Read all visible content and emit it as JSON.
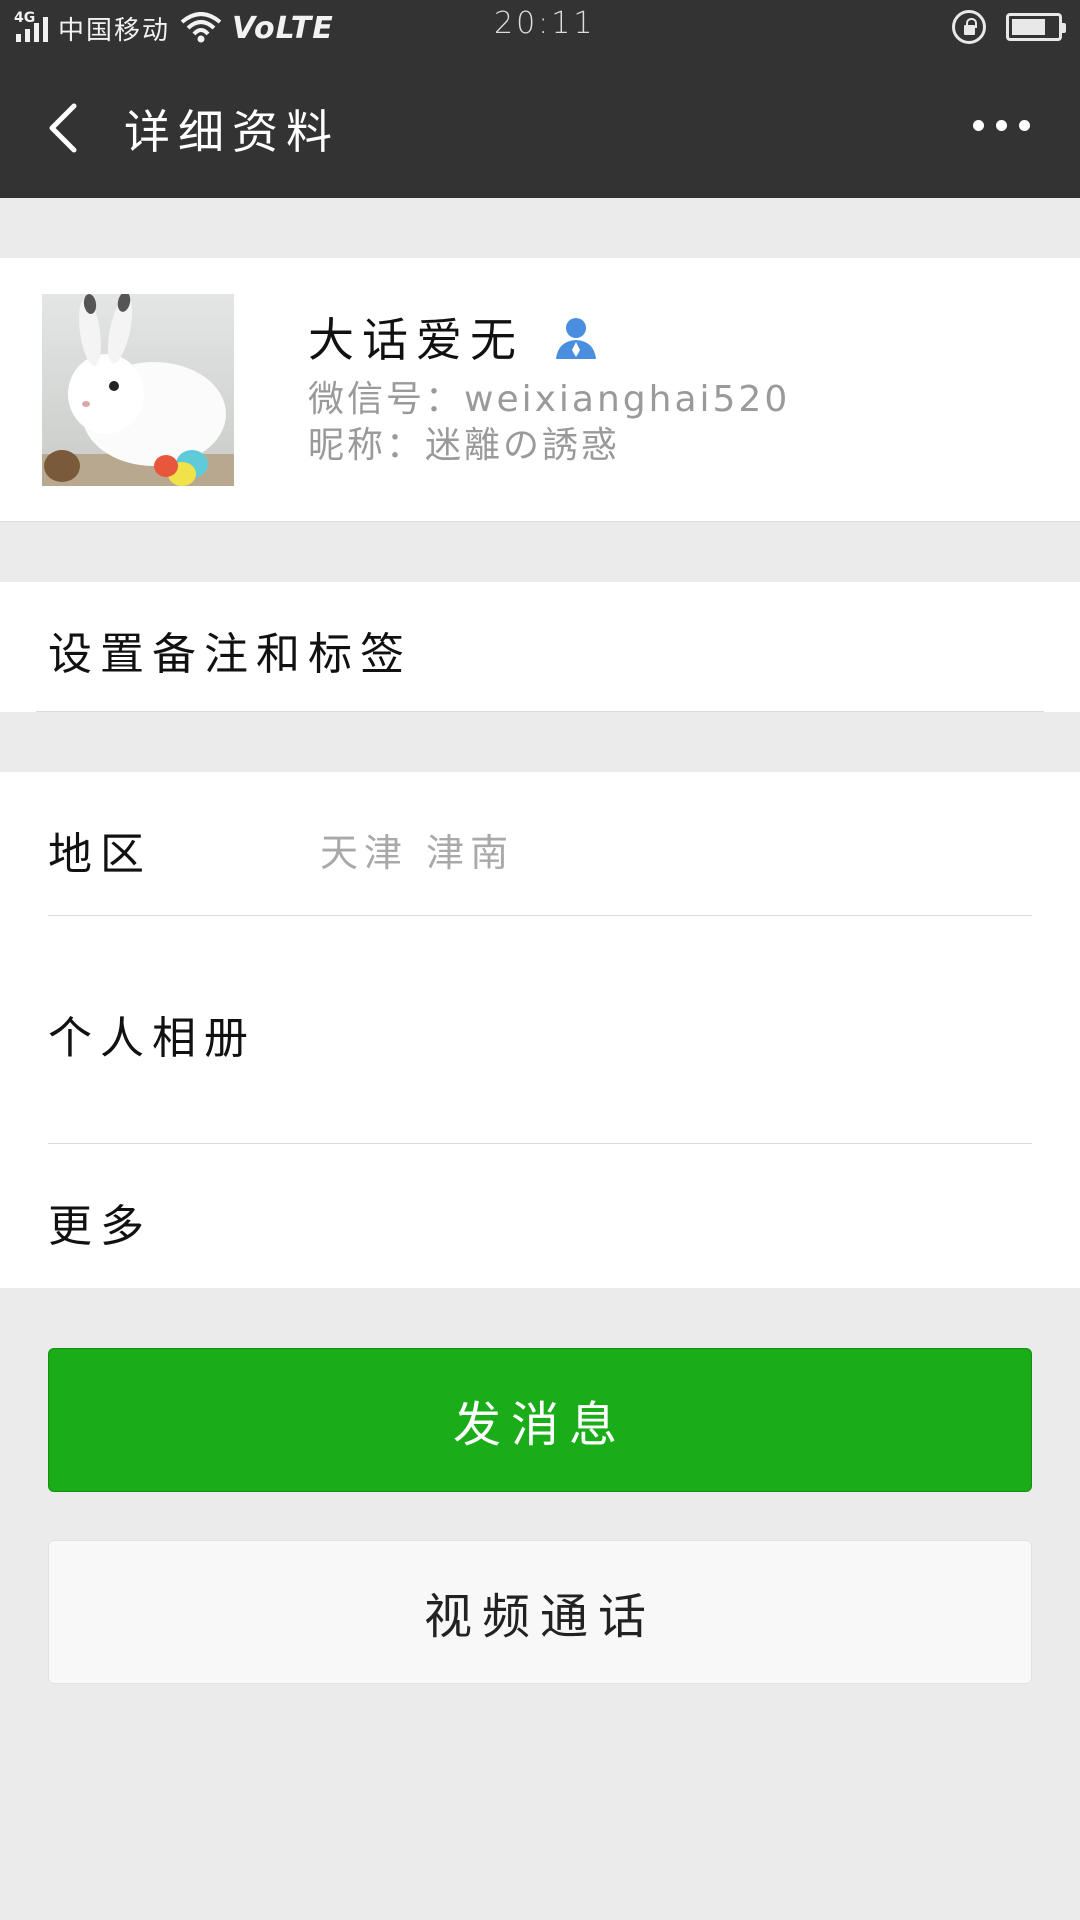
{
  "status_bar": {
    "network": "4G",
    "carrier": "中国移动",
    "volte": "VoLTE",
    "time": "20:11",
    "battery_level": 0.75
  },
  "header": {
    "title": "详细资料"
  },
  "profile": {
    "name": "大话爱无",
    "wechat_id": "微信号：weixianghai520",
    "nickname": "昵称：迷離の誘惑"
  },
  "remark": {
    "label": "设置备注和标签"
  },
  "info": {
    "region_label": "地区",
    "region_value": "天津  津南",
    "album_label": "个人相册",
    "more_label": "更多"
  },
  "actions": {
    "send_message": "发消息",
    "video_call": "视频通话"
  },
  "colors": {
    "header_bg": "#333333",
    "primary_green": "#1aad19",
    "page_bg": "#ebebeb",
    "contact_icon": "#4a8ee0"
  }
}
